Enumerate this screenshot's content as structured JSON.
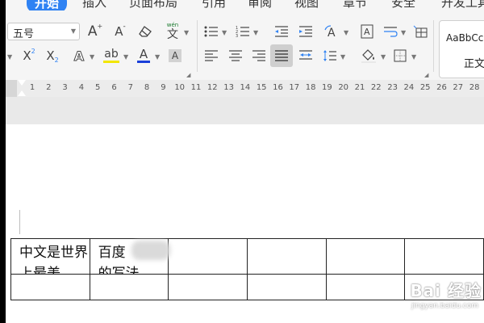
{
  "tabs": [
    {
      "label": "开始",
      "active": true
    },
    {
      "label": "插入"
    },
    {
      "label": "页面布局"
    },
    {
      "label": "引用"
    },
    {
      "label": "审阅"
    },
    {
      "label": "视图"
    },
    {
      "label": "章节"
    },
    {
      "label": "安全"
    },
    {
      "label": "开发工具"
    }
  ],
  "ribbon": {
    "font_size_value": "五号",
    "bigger_font": "A",
    "smaller_font": "A",
    "pinyin_label": "文",
    "pinyin_ruby": "wén",
    "superscript": "X",
    "superscript_mark": "2",
    "subscript": "X",
    "subscript_mark": "2",
    "font_color_label": "A",
    "highlight_label": "ab",
    "char_shading_label": "A",
    "text_effect_label": "A",
    "style_preview": "AaBbCcI",
    "style_name": "正文",
    "accent_color": "#2f82f3"
  },
  "ruler": {
    "numbers": [
      "1",
      "2",
      "3",
      "4",
      "5",
      "6",
      "7",
      "8",
      "9",
      "10",
      "11",
      "12",
      "13",
      "14",
      "15",
      "16",
      "17",
      "18",
      "19",
      "20",
      "21",
      "22",
      "23",
      "24",
      "25",
      "26",
      "27",
      "28"
    ]
  },
  "document": {
    "table": {
      "rows": [
        [
          "中文是世界上最美",
          "百度",
          "",
          "",
          "",
          ""
        ],
        [
          "",
          "",
          "",
          "",
          "",
          ""
        ]
      ],
      "row1_col2_line2": "的写法"
    }
  },
  "watermark": {
    "main": "Bai 经验",
    "sub": "jingyan.baidu.com"
  }
}
